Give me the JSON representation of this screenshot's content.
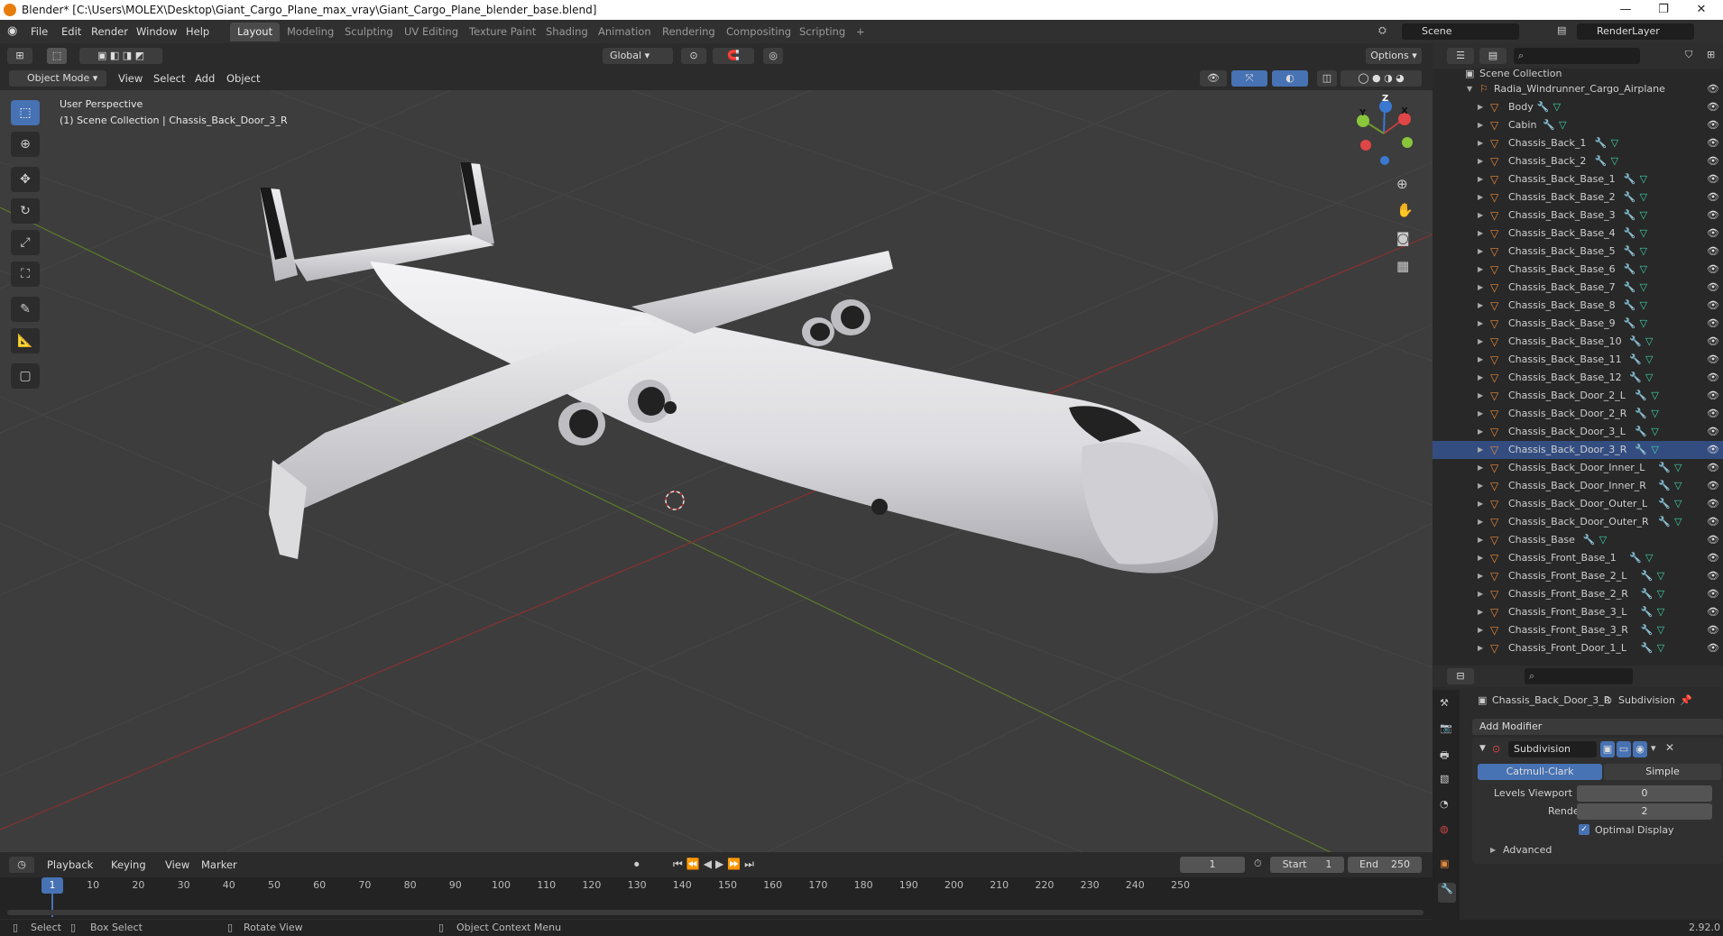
{
  "window": {
    "title": "Blender* [C:\\Users\\MOLEX\\Desktop\\Giant_Cargo_Plane_max_vray\\Giant_Cargo_Plane_blender_base.blend]",
    "minimize": "—",
    "maximize": "❐",
    "close": "✕"
  },
  "menu": [
    "File",
    "Edit",
    "Render",
    "Window",
    "Help"
  ],
  "workspaces": [
    "Layout",
    "Modeling",
    "Sculpting",
    "UV Editing",
    "Texture Paint",
    "Shading",
    "Animation",
    "Rendering",
    "Compositing",
    "Scripting"
  ],
  "active_workspace": "Layout",
  "add_workspace": "+",
  "scene": "Scene",
  "render_layer": "RenderLayer",
  "viewport_header": {
    "mode": "Object Mode",
    "menus": [
      "View",
      "Select",
      "Add",
      "Object"
    ],
    "orientation": "Global",
    "options": "Options"
  },
  "viewport": {
    "perspective": "User Perspective",
    "collection_info": "(1) Scene Collection | Chassis_Back_Door_3_R",
    "gizmo": {
      "x": "X",
      "y": "Y",
      "z": "Z"
    }
  },
  "outliner": {
    "root": "Scene Collection",
    "collection": "Radia_Windrunner_Cargo_Airplane",
    "items": [
      "Body",
      "Cabin",
      "Chassis_Back_1",
      "Chassis_Back_2",
      "Chassis_Back_Base_1",
      "Chassis_Back_Base_2",
      "Chassis_Back_Base_3",
      "Chassis_Back_Base_4",
      "Chassis_Back_Base_5",
      "Chassis_Back_Base_6",
      "Chassis_Back_Base_7",
      "Chassis_Back_Base_8",
      "Chassis_Back_Base_9",
      "Chassis_Back_Base_10",
      "Chassis_Back_Base_11",
      "Chassis_Back_Base_12",
      "Chassis_Back_Door_2_L",
      "Chassis_Back_Door_2_R",
      "Chassis_Back_Door_3_L",
      "Chassis_Back_Door_3_R",
      "Chassis_Back_Door_Inner_L",
      "Chassis_Back_Door_Inner_R",
      "Chassis_Back_Door_Outer_L",
      "Chassis_Back_Door_Outer_R",
      "Chassis_Base",
      "Chassis_Front_Base_1",
      "Chassis_Front_Base_2_L",
      "Chassis_Front_Base_2_R",
      "Chassis_Front_Base_3_L",
      "Chassis_Front_Base_3_R",
      "Chassis_Front_Door_1_L"
    ],
    "selected": "Chassis_Back_Door_3_R"
  },
  "properties": {
    "object": "Chassis_Back_Door_3_R",
    "modifier_tab": "Subdivision",
    "add_modifier": "Add Modifier",
    "modifier_name": "Subdivision",
    "mode_a": "Catmull-Clark",
    "mode_b": "Simple",
    "levels_viewport_label": "Levels Viewport",
    "levels_viewport": "0",
    "render_label": "Render",
    "render_value": "2",
    "optimal_display": "Optimal Display",
    "advanced": "Advanced"
  },
  "timeline": {
    "menus": [
      "Playback",
      "Keying",
      "View",
      "Marker"
    ],
    "current_frame": "1",
    "start_label": "Start",
    "start": "1",
    "end_label": "End",
    "end": "250",
    "ticks": [
      "1",
      "10",
      "20",
      "30",
      "40",
      "50",
      "60",
      "70",
      "80",
      "90",
      "100",
      "110",
      "120",
      "130",
      "140",
      "150",
      "160",
      "170",
      "180",
      "190",
      "200",
      "210",
      "220",
      "230",
      "240",
      "250"
    ]
  },
  "statusbar": {
    "select": "Select",
    "box_select": "Box Select",
    "rotate_view": "Rotate View",
    "context_menu": "Object Context Menu",
    "version": "2.92.0"
  },
  "colors": {
    "accent": "#4772b3",
    "object_icon": "#e6893a",
    "mesh_icon": "#3ed4a8",
    "x_axis": "#9a3a3a",
    "y_axis": "#6a8a2a"
  }
}
